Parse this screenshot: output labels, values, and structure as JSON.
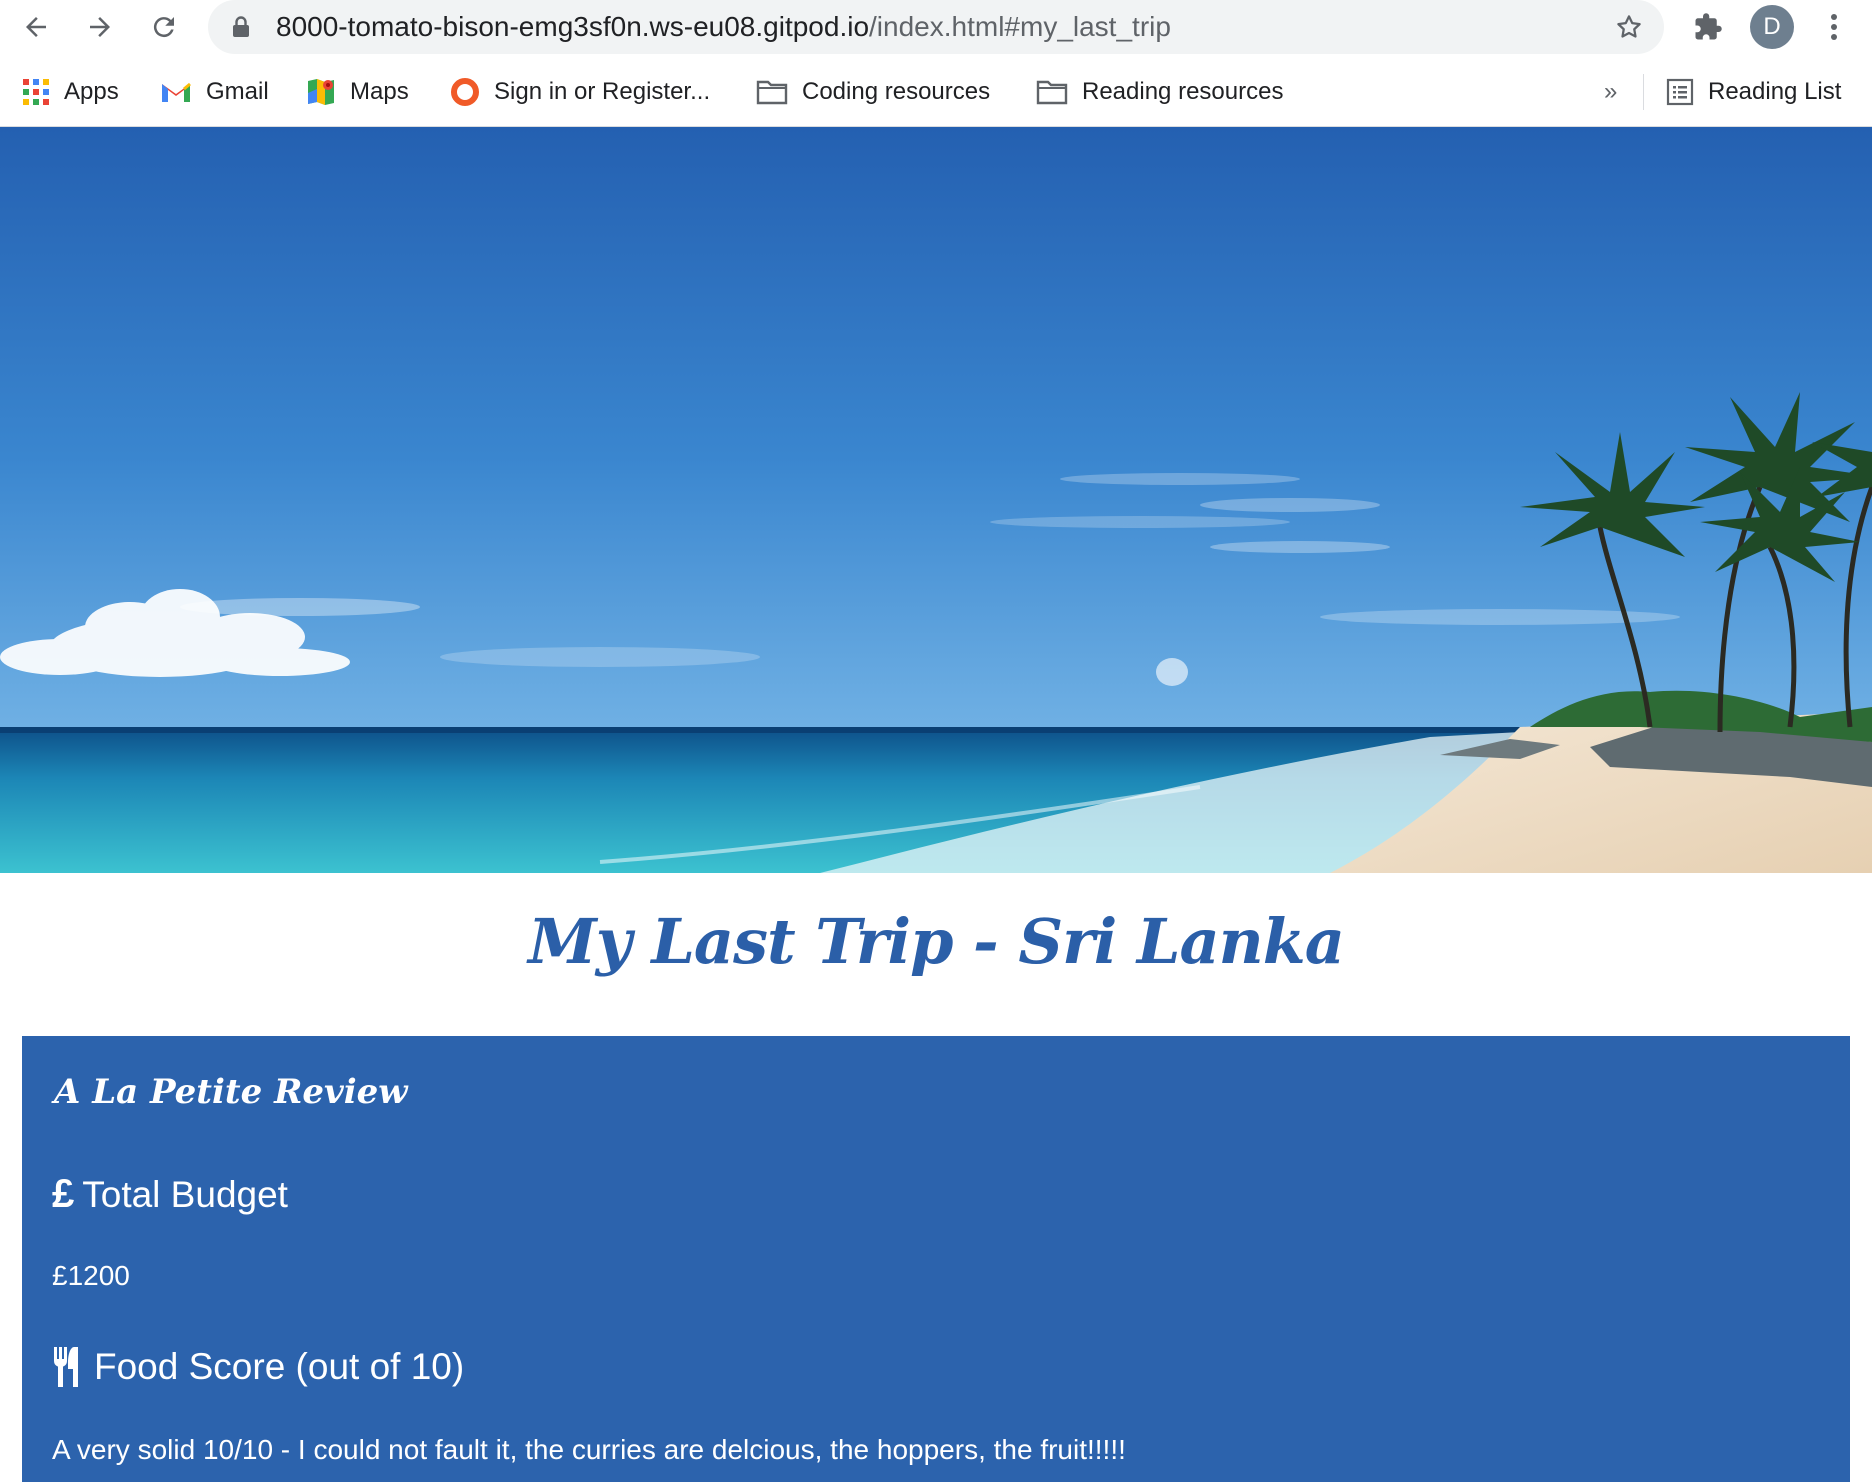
{
  "browser": {
    "url_host": "8000-tomato-bison-emg3sf0n.ws-eu08.gitpod.io",
    "url_path": "/index.html#my_last_trip",
    "profile_initial": "D",
    "bookmarks": [
      {
        "label": "Apps",
        "icon": "apps-grid-icon"
      },
      {
        "label": "Gmail",
        "icon": "gmail-icon"
      },
      {
        "label": "Maps",
        "icon": "maps-icon"
      },
      {
        "label": "Sign in or Register...",
        "icon": "ring-icon"
      },
      {
        "label": "Coding resources",
        "icon": "folder-icon"
      },
      {
        "label": "Reading resources",
        "icon": "folder-icon"
      }
    ],
    "overflow_label": "»",
    "reading_list_label": "Reading List"
  },
  "page": {
    "title": "My Last Trip - Sri Lanka",
    "review": {
      "heading": "A La Petite Review",
      "budget_heading": "Total Budget",
      "budget_value": "£1200",
      "food_heading": "Food Score (out of 10)",
      "food_text": "A very solid 10/10 - I could not fault it, the curries are delcious, the hoppers, the fruit!!!!!"
    }
  },
  "colors": {
    "accent": "#2b5fa8",
    "panel": "#2c63ad",
    "omnibox": "#f1f3f4"
  }
}
